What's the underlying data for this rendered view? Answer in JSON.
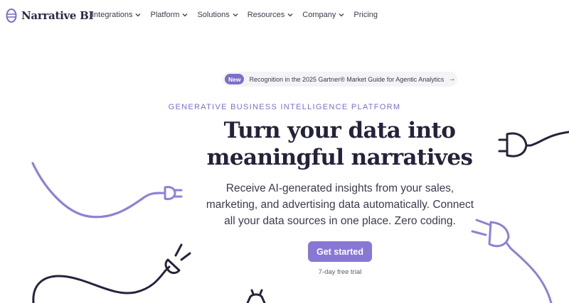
{
  "brand": {
    "name": "Narrative BI"
  },
  "nav": {
    "items": [
      {
        "label": "Integrations",
        "dropdown": true
      },
      {
        "label": "Platform",
        "dropdown": true
      },
      {
        "label": "Solutions",
        "dropdown": true
      },
      {
        "label": "Resources",
        "dropdown": true
      },
      {
        "label": "Company",
        "dropdown": true
      },
      {
        "label": "Pricing",
        "dropdown": false
      }
    ]
  },
  "announcement": {
    "pill": "New",
    "text": "Recognition in the 2025 Gartner® Market Guide for Agentic Analytics",
    "arrow": "→"
  },
  "hero": {
    "eyebrow": "GENERATIVE BUSINESS INTELLIGENCE PLATFORM",
    "title_line1": "Turn your data into",
    "title_line2": "meaningful narratives",
    "subtitle_line1": "Receive AI-generated insights from your sales,",
    "subtitle_line2": "marketing, and advertising data automatically. Connect",
    "subtitle_line3": "all your data sources in one place. Zero coding.",
    "cta_label": "Get started",
    "trial_note": "7-day free trial"
  },
  "colors": {
    "accent": "#8877d4",
    "pill": "#7b6fc9",
    "title": "#24233a",
    "doodle_purple": "#8f80d6",
    "doodle_dark": "#26243a"
  }
}
